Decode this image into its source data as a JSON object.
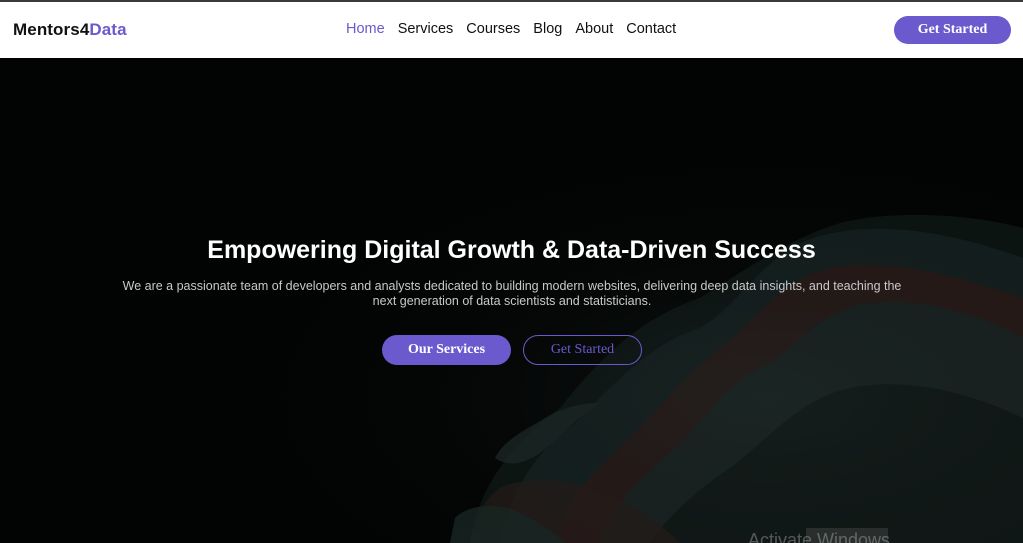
{
  "brand": {
    "name_main": "Mentors4",
    "name_accent": "Data"
  },
  "nav": {
    "items": [
      {
        "label": "Home",
        "active": true
      },
      {
        "label": "Services",
        "active": false
      },
      {
        "label": "Courses",
        "active": false
      },
      {
        "label": "Blog",
        "active": false
      },
      {
        "label": "About",
        "active": false
      },
      {
        "label": "Contact",
        "active": false
      }
    ],
    "cta_label": "Get Started"
  },
  "hero": {
    "headline": "Empowering Digital Growth & Data-Driven Success",
    "subtext": "We are a passionate team of developers and analysts dedicated to building modern websites, delivering deep data insights, and teaching the next generation of data scientists and statisticians.",
    "primary_button": "Our Services",
    "secondary_button": "Get Started"
  },
  "watermark": {
    "text": "Activate Windows"
  },
  "colors": {
    "accent": "#6a5acd",
    "navbar_bg": "#ffffff",
    "hero_bg": "#020303"
  }
}
